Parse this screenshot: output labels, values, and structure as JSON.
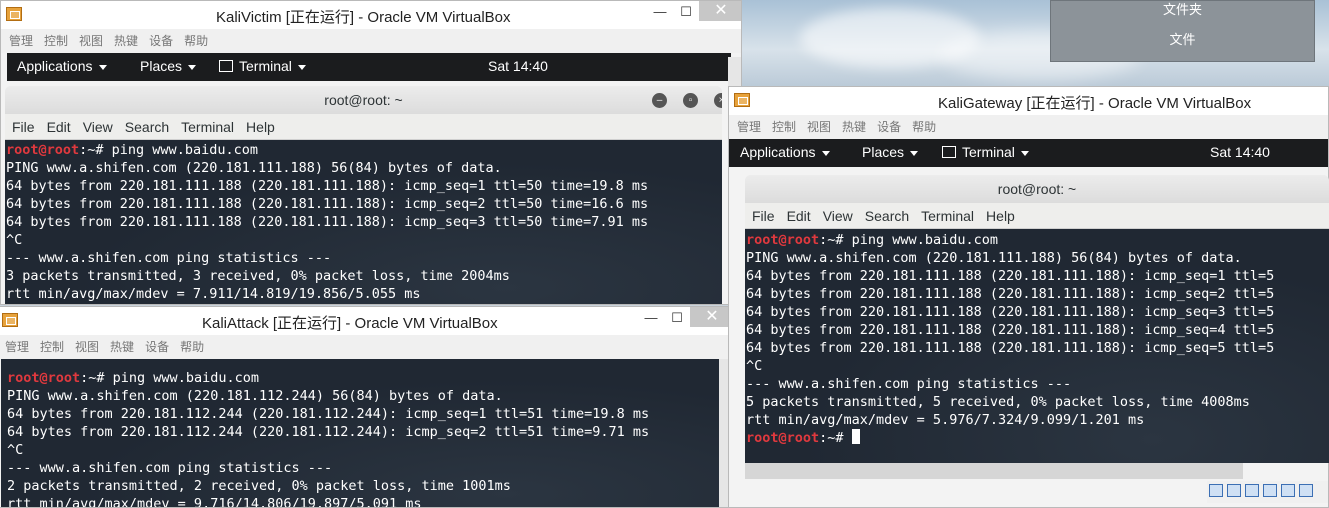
{
  "desktop": {
    "folder_items": [
      "文件夹",
      "文件"
    ]
  },
  "vm_menu": [
    "管理",
    "控制",
    "视图",
    "热键",
    "设备",
    "帮助"
  ],
  "kali_panel": {
    "applications": "Applications",
    "places": "Places",
    "terminal": "Terminal",
    "clock": "Sat 14:40"
  },
  "terminal_menu": [
    "File",
    "Edit",
    "View",
    "Search",
    "Terminal",
    "Help"
  ],
  "victim": {
    "title": "KaliVictim [正在运行] - Oracle VM VirtualBox",
    "term_title": "root@root: ~",
    "lines": [
      {
        "prompt": "root@root",
        "rest": ":~# ping www.baidu.com"
      },
      {
        "text": "PING www.a.shifen.com (220.181.111.188) 56(84) bytes of data."
      },
      {
        "text": "64 bytes from 220.181.111.188 (220.181.111.188): icmp_seq=1 ttl=50 time=19.8 ms"
      },
      {
        "text": "64 bytes from 220.181.111.188 (220.181.111.188): icmp_seq=2 ttl=50 time=16.6 ms"
      },
      {
        "text": "64 bytes from 220.181.111.188 (220.181.111.188): icmp_seq=3 ttl=50 time=7.91 ms"
      },
      {
        "text": "^C"
      },
      {
        "text": "--- www.a.shifen.com ping statistics ---"
      },
      {
        "text": "3 packets transmitted, 3 received, 0% packet loss, time 2004ms"
      },
      {
        "text": "rtt min/avg/max/mdev = 7.911/14.819/19.856/5.055 ms"
      }
    ]
  },
  "attack": {
    "title": "KaliAttack [正在运行] - Oracle VM VirtualBox",
    "lines": [
      {
        "prompt": "root@root",
        "rest": ":~# ping www.baidu.com"
      },
      {
        "text": "PING www.a.shifen.com (220.181.112.244) 56(84) bytes of data."
      },
      {
        "text": "64 bytes from 220.181.112.244 (220.181.112.244): icmp_seq=1 ttl=51 time=19.8 ms"
      },
      {
        "text": "64 bytes from 220.181.112.244 (220.181.112.244): icmp_seq=2 ttl=51 time=9.71 ms"
      },
      {
        "text": "^C"
      },
      {
        "text": "--- www.a.shifen.com ping statistics ---"
      },
      {
        "text": "2 packets transmitted, 2 received, 0% packet loss, time 1001ms"
      },
      {
        "text": "rtt min/avg/max/mdev = 9.716/14.806/19.897/5.091 ms"
      }
    ]
  },
  "gateway": {
    "title": "KaliGateway [正在运行] - Oracle VM VirtualBox",
    "term_title": "root@root: ~",
    "lines": [
      {
        "prompt": "root@root",
        "rest": ":~# ping www.baidu.com"
      },
      {
        "text": "PING www.a.shifen.com (220.181.111.188) 56(84) bytes of data."
      },
      {
        "text": "64 bytes from 220.181.111.188 (220.181.111.188): icmp_seq=1 ttl=5"
      },
      {
        "text": "64 bytes from 220.181.111.188 (220.181.111.188): icmp_seq=2 ttl=5"
      },
      {
        "text": "64 bytes from 220.181.111.188 (220.181.111.188): icmp_seq=3 ttl=5"
      },
      {
        "text": "64 bytes from 220.181.111.188 (220.181.111.188): icmp_seq=4 ttl=5"
      },
      {
        "text": "64 bytes from 220.181.111.188 (220.181.111.188): icmp_seq=5 ttl=5"
      },
      {
        "text": "^C"
      },
      {
        "text": "--- www.a.shifen.com ping statistics ---"
      },
      {
        "text": "5 packets transmitted, 5 received, 0% packet loss, time 4008ms"
      },
      {
        "text": "rtt min/avg/max/mdev = 5.976/7.324/9.099/1.201 ms"
      },
      {
        "prompt": "root@root",
        "rest": ":~# ",
        "cursor": true
      }
    ]
  },
  "colors": {
    "prompt": "#e0393e",
    "terminal_bg": "#202833",
    "panel_bg": "#1b1c1e"
  }
}
